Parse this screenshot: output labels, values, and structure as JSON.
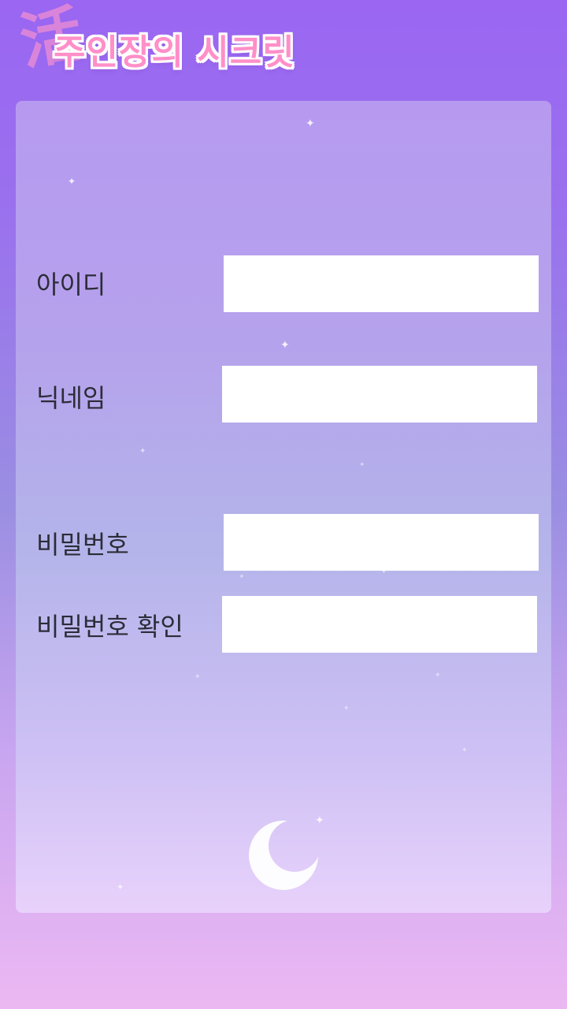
{
  "app": {
    "logo_glyph": "活",
    "title": "주인장의 시크릿"
  },
  "form": {
    "id_label": "아이디",
    "id_value": "",
    "nickname_label": "닉네임",
    "nickname_value": "",
    "password_label": "비밀번호",
    "password_value": "",
    "password_confirm_label": "비밀번호 확인",
    "password_confirm_value": ""
  },
  "decorations": {
    "star_glyph": "✦",
    "moon_icon": "crescent-moon-icon"
  },
  "colors": {
    "background_top": "#9a66f2",
    "background_bottom": "#ecb8f2",
    "title_pink": "#ff8fc8",
    "label_text": "#2c2c38",
    "input_background": "#ffffff"
  }
}
